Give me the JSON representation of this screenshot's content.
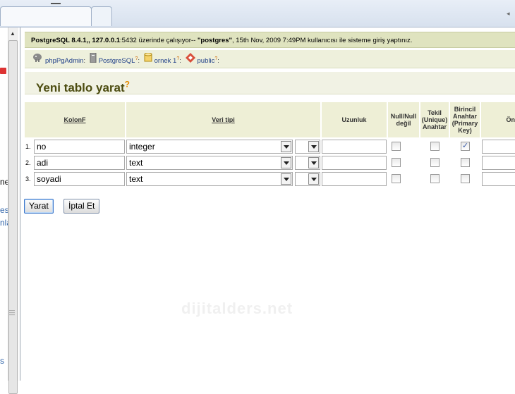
{
  "browser": {
    "scroll_glyph": "◂"
  },
  "sidebar": {
    "edge_texts": [
      "ne",
      "es",
      "nla",
      "s"
    ]
  },
  "infobar": {
    "server": "PostgreSQL 8.4.1,",
    "host": ", 127.0.0.1",
    "port": ":5432",
    "text_a": " üzerinde çalışıyor-- ",
    "user": "\"postgres\"",
    "text_b": ", 15th Nov, 2009 7:49PM kullanıcısı ile sisteme giriş yaptınız."
  },
  "breadcrumb": {
    "items": [
      {
        "label": "phpPgAdmin",
        "icon": "elephant-icon",
        "sep": ":"
      },
      {
        "label": "PostgreSQL",
        "icon": "server-icon",
        "mark": "?",
        "sep": ":"
      },
      {
        "label": "ornek 1",
        "icon": "database-icon",
        "mark": "?",
        "sep": ":"
      },
      {
        "label": "public",
        "icon": "schema-icon",
        "mark": "?",
        "sep": ":"
      }
    ]
  },
  "page": {
    "title": "Yeni tablo yarat",
    "help_mark": "?",
    "watermark": "dijitalders.net"
  },
  "table": {
    "headers": {
      "column": "KolonF",
      "type": "Veri tipi",
      "length": "Uzunluk",
      "null": "Null/Null değil",
      "unique": "Tekil (Unique) Anahtar",
      "primary": "Birincil Anahtar (Primary Key)",
      "default": "Ön"
    },
    "rows": [
      {
        "num": "1.",
        "name": "no",
        "type": "integer",
        "length": "",
        "null": false,
        "unique": false,
        "primary": true
      },
      {
        "num": "2.",
        "name": "adi",
        "type": "text",
        "length": "",
        "null": false,
        "unique": false,
        "primary": false
      },
      {
        "num": "3.",
        "name": "soyadi",
        "type": "text",
        "length": "",
        "null": false,
        "unique": false,
        "primary": false
      }
    ]
  },
  "buttons": {
    "create": "Yarat",
    "cancel": "İptal Et"
  },
  "colors": {
    "infobar_bg": "#dfe3bf",
    "title_color": "#4c4c10",
    "help_color": "#e58c00"
  }
}
